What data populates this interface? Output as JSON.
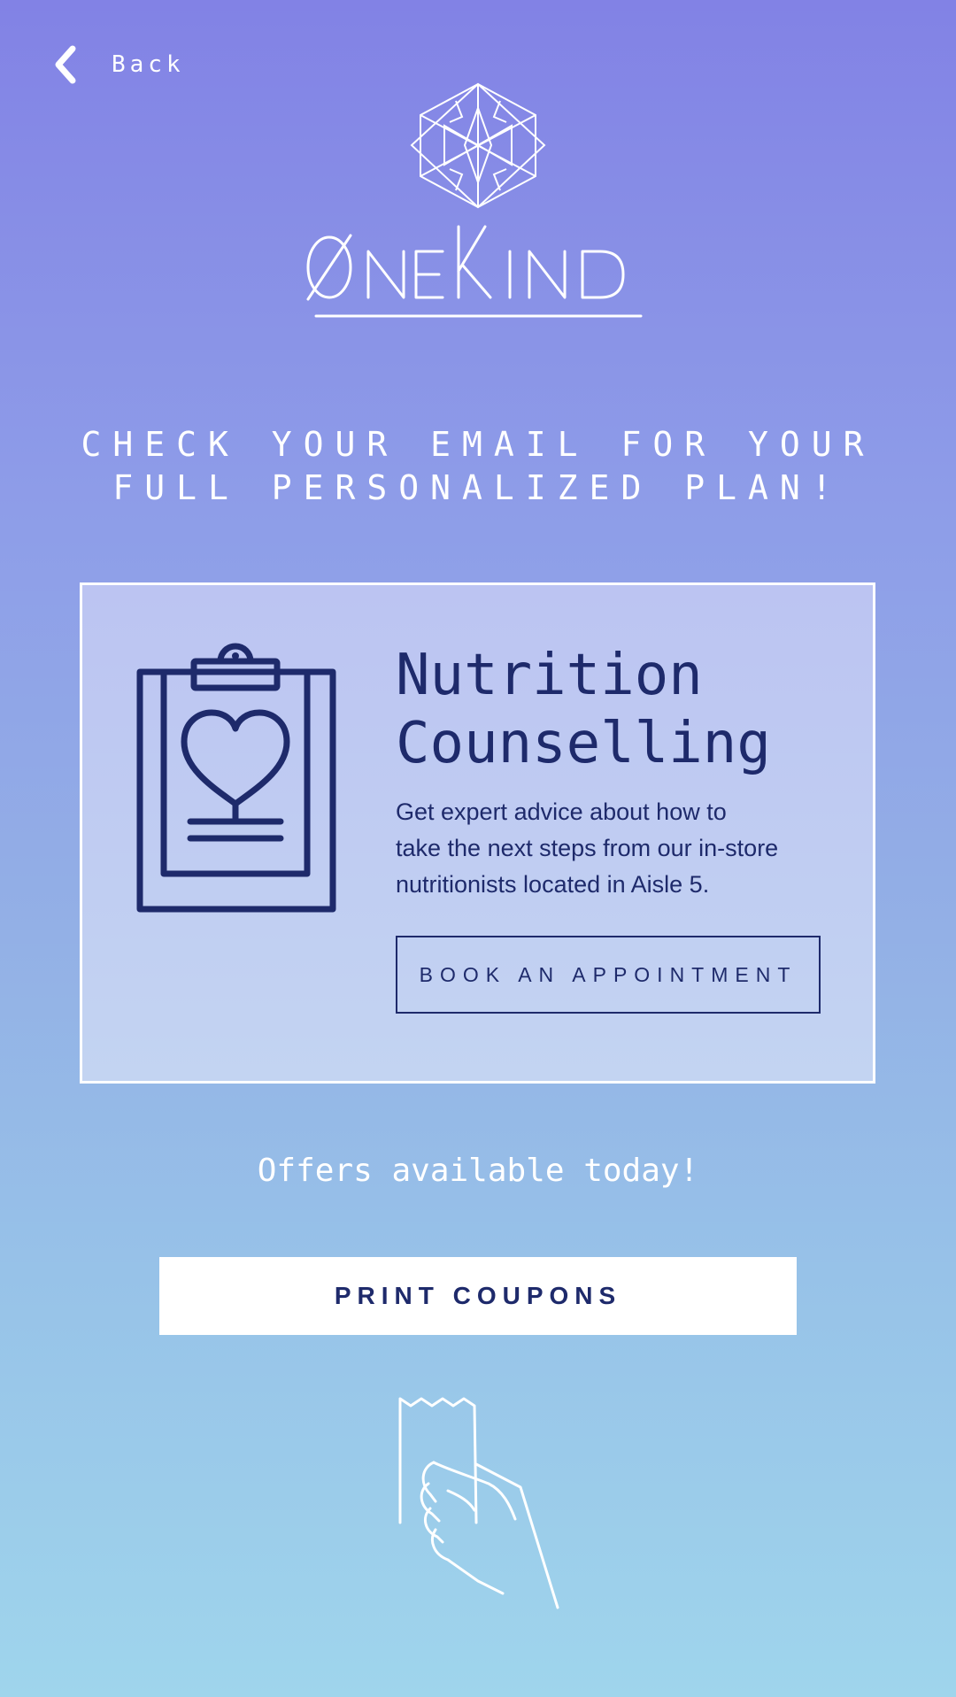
{
  "nav": {
    "back_label": "Back"
  },
  "brand": {
    "name": "OneKind"
  },
  "headline": {
    "line1": "CHECK YOUR EMAIL FOR YOUR",
    "line2": "FULL PERSONALIZED PLAN!"
  },
  "card": {
    "title_line1": "Nutrition",
    "title_line2": "Counselling",
    "description_line1": "Get expert advice about how to",
    "description_line2": "take the next steps from our in-store",
    "description_line3": "nutritionists located in Aisle 5.",
    "button_label": "BOOK AN APPOINTMENT",
    "icon": "clipboard-heart-icon"
  },
  "offers": {
    "text": "Offers available today!",
    "button_label": "PRINT COUPONS",
    "illustration": "hand-holding-coupon-icon"
  },
  "colors": {
    "accent_navy": "#1e2a6b",
    "gradient_top": "#8282e5",
    "gradient_bottom": "#9fd5ec",
    "card_bg": "#bcc4f2",
    "white": "#ffffff"
  }
}
